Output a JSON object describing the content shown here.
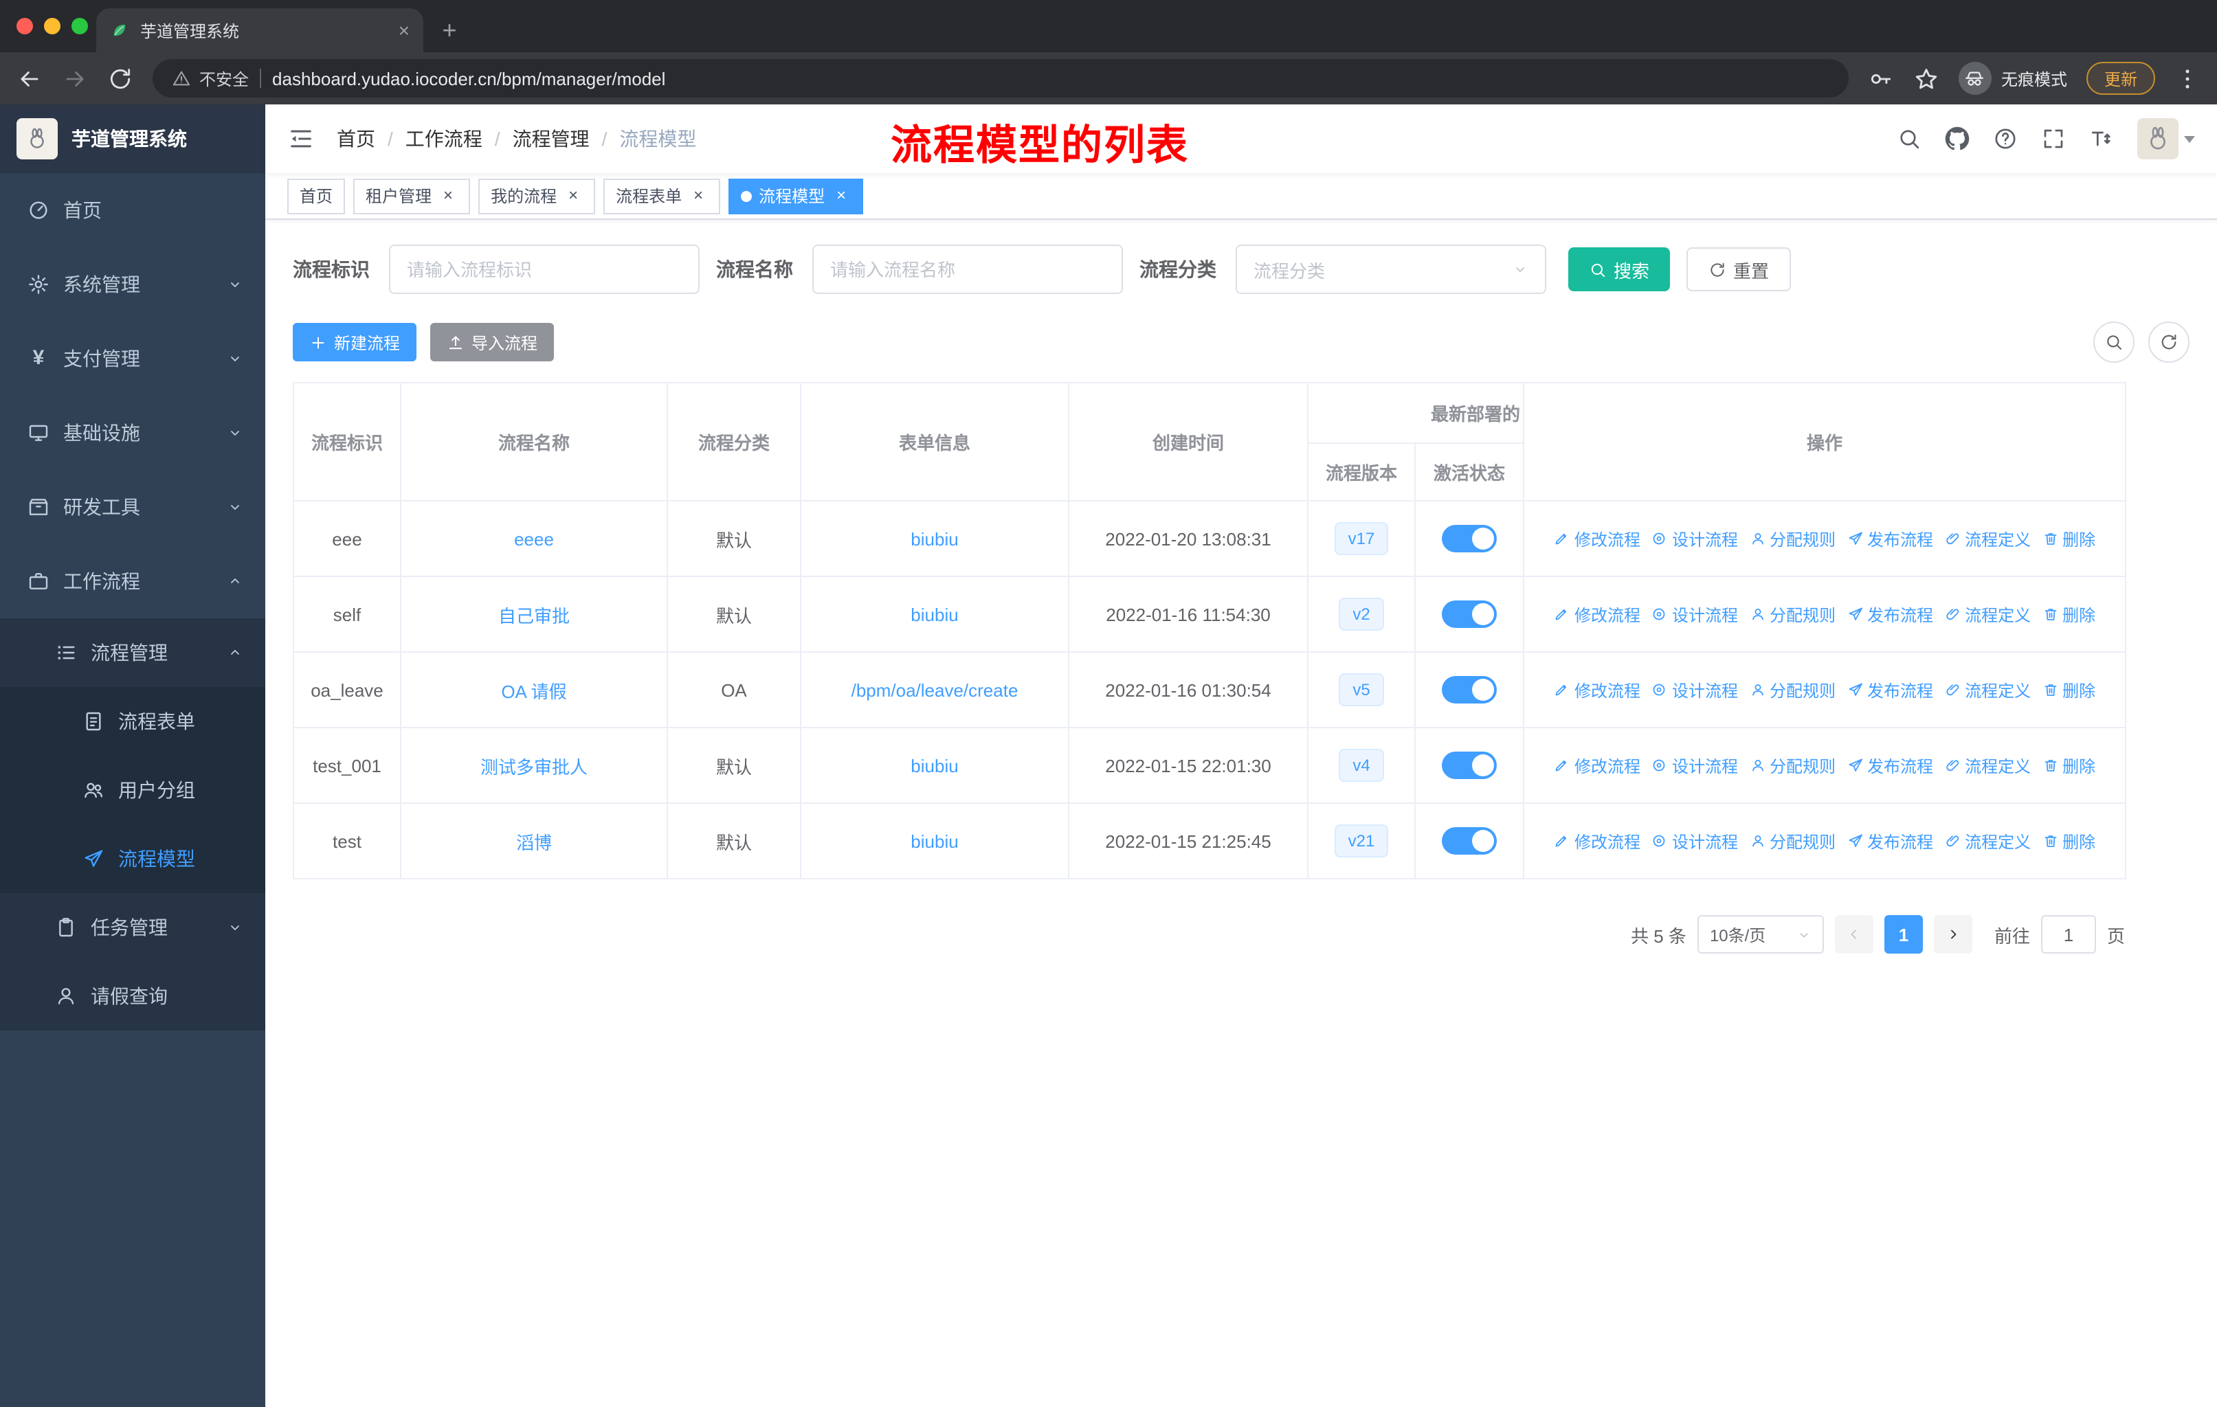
{
  "browser": {
    "tab": {
      "title": "芋道管理系统",
      "close": "×",
      "new_tab": "+"
    },
    "address": {
      "security_label": "不安全",
      "url": "dashboard.yudao.iocoder.cn/bpm/manager/model"
    },
    "incognito_label": "无痕模式",
    "update_label": "更新"
  },
  "sidebar": {
    "logo_title": "芋道管理系统",
    "items": [
      {
        "label": "首页",
        "icon": "dashboard-icon"
      },
      {
        "label": "系统管理",
        "icon": "gear-icon",
        "chevron": "down"
      },
      {
        "label": "支付管理",
        "icon": "yen-icon",
        "chevron": "down",
        "icon_glyph": "¥"
      },
      {
        "label": "基础设施",
        "icon": "infrastructure-icon",
        "chevron": "down"
      },
      {
        "label": "研发工具",
        "icon": "devtools-icon",
        "chevron": "down"
      },
      {
        "label": "工作流程",
        "icon": "workflow-icon",
        "chevron": "up"
      },
      {
        "label": "流程管理",
        "icon": "process-manage-icon",
        "chevron": "up"
      },
      {
        "label": "流程表单",
        "icon": "form-icon"
      },
      {
        "label": "用户分组",
        "icon": "user-group-icon"
      },
      {
        "label": "流程模型",
        "icon": "model-icon",
        "active": true
      },
      {
        "label": "任务管理",
        "icon": "task-icon",
        "chevron": "down"
      },
      {
        "label": "请假查询",
        "icon": "person-icon"
      }
    ]
  },
  "navbar": {
    "breadcrumb": [
      "首页",
      "工作流程",
      "流程管理",
      "流程模型"
    ],
    "annotation": "流程模型的列表"
  },
  "tags": [
    {
      "label": "首页",
      "closable": false,
      "active": false
    },
    {
      "label": "租户管理",
      "closable": true,
      "active": false
    },
    {
      "label": "我的流程",
      "closable": true,
      "active": false
    },
    {
      "label": "流程表单",
      "closable": true,
      "active": false
    },
    {
      "label": "流程模型",
      "closable": true,
      "active": true
    }
  ],
  "filters": {
    "id_label": "流程标识",
    "id_placeholder": "请输入流程标识",
    "name_label": "流程名称",
    "name_placeholder": "请输入流程名称",
    "category_label": "流程分类",
    "category_placeholder": "流程分类",
    "search_label": "搜索",
    "reset_label": "重置"
  },
  "toolbar": {
    "create_label": "新建流程",
    "import_label": "导入流程"
  },
  "table": {
    "headers": {
      "id": "流程标识",
      "name": "流程名称",
      "category": "流程分类",
      "form": "表单信息",
      "created": "创建时间",
      "deploy_group": "最新部署的",
      "version": "流程版本",
      "active": "激活状态",
      "ops": "操作"
    },
    "op_labels": [
      "修改流程",
      "设计流程",
      "分配规则",
      "发布流程",
      "流程定义",
      "删除"
    ],
    "rows": [
      {
        "id": "eee",
        "name": "eeee",
        "category": "默认",
        "form": "biubiu",
        "created": "2022-01-20 13:08:31",
        "version": "v17",
        "active": true
      },
      {
        "id": "self",
        "name": "自己审批",
        "category": "默认",
        "form": "biubiu",
        "created": "2022-01-16 11:54:30",
        "version": "v2",
        "active": true
      },
      {
        "id": "oa_leave",
        "name": "OA 请假",
        "category": "OA",
        "form": "/bpm/oa/leave/create",
        "created": "2022-01-16 01:30:54",
        "version": "v5",
        "active": true
      },
      {
        "id": "test_001",
        "name": "测试多审批人",
        "category": "默认",
        "form": "biubiu",
        "created": "2022-01-15 22:01:30",
        "version": "v4",
        "active": true
      },
      {
        "id": "test",
        "name": "滔博",
        "category": "默认",
        "form": "biubiu",
        "created": "2022-01-15 21:25:45",
        "version": "v21",
        "active": true
      }
    ]
  },
  "pagination": {
    "total": "共 5 条",
    "page_size": "10条/页",
    "page": "1",
    "goto_label": "前往",
    "goto_value": "1",
    "page_suffix": "页"
  },
  "colors": {
    "accent": "#409eff",
    "search_button": "#18bc9c",
    "sidebar_bg": "#304156",
    "annotation": "#ff0000",
    "toggle_on": "#409eff",
    "version_tag_bg": "#ecf5ff"
  }
}
